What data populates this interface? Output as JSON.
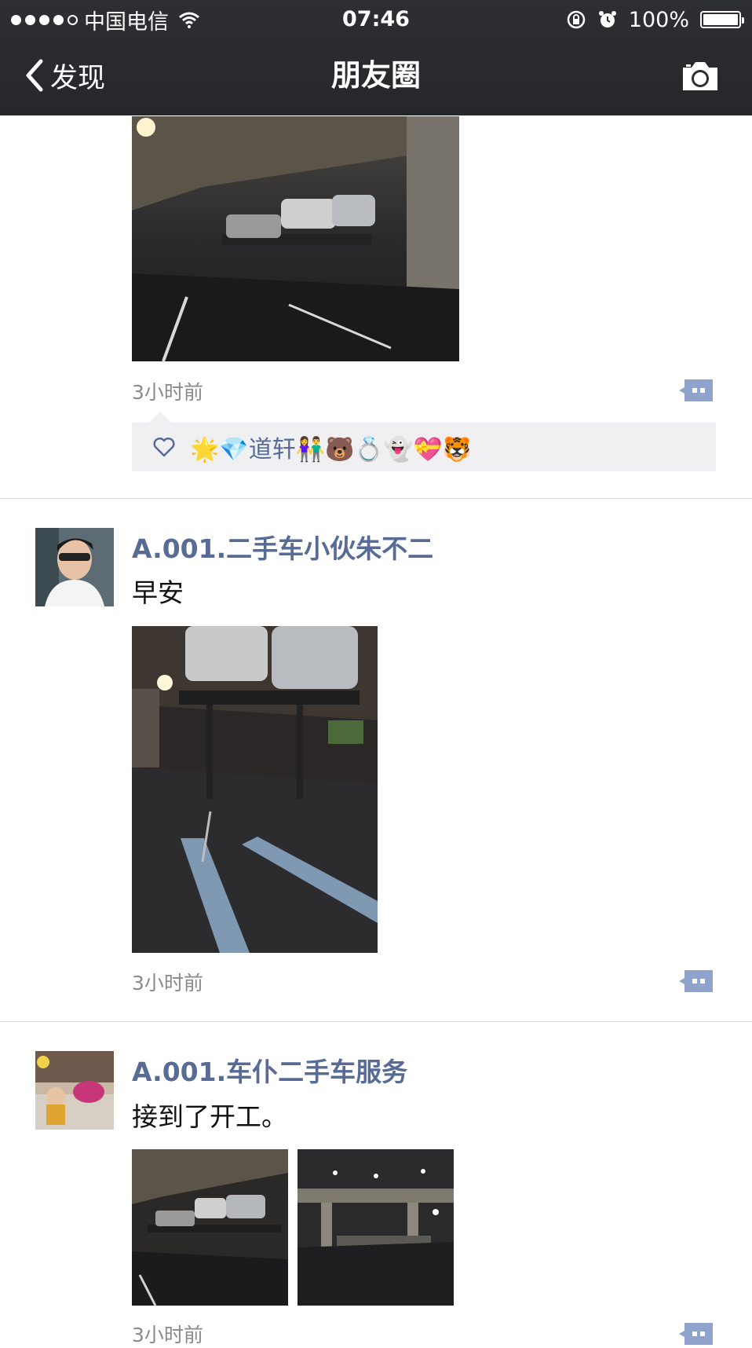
{
  "status_bar": {
    "carrier": "中国电信",
    "time": "07:46",
    "battery": "100%"
  },
  "nav": {
    "back_label": "发现",
    "title": "朋友圈"
  },
  "feed": [
    {
      "time": "3小时前",
      "likes": "🌟💎道轩👫🐻💍👻💝🐯"
    },
    {
      "author": "A.001.二手车小伙朱不二",
      "text": "早安",
      "time": "3小时前"
    },
    {
      "author": "A.001.车仆二手车服务",
      "text": "接到了开工。",
      "time": "3小时前"
    }
  ],
  "colors": {
    "nav_bg": "#2e2f33",
    "author_name": "#576b95",
    "likes_bg": "#f0f0f2",
    "separator": "#dcdcdc",
    "comment_button": "#8fa3cc"
  },
  "icons": {
    "signal": "signal-dots-icon",
    "wifi": "wifi-icon",
    "orientation_lock": "orientation-lock-icon",
    "alarm": "alarm-icon",
    "battery": "battery-icon",
    "back": "chevron-left-icon",
    "camera": "camera-icon",
    "comment": "comment-icon",
    "like": "heart-icon"
  }
}
